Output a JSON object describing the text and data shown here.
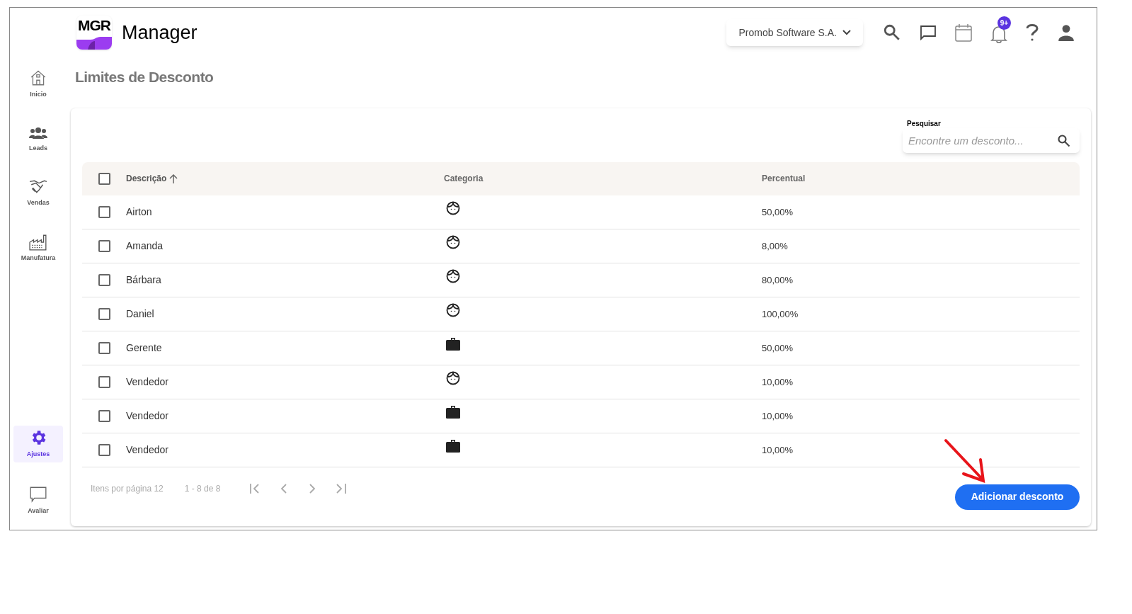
{
  "header": {
    "logo_text": "MGR",
    "app_name": "Manager",
    "company": "Promob Software S.A.",
    "notification_badge": "9+"
  },
  "sidebar": {
    "items": [
      {
        "label": "Inicio",
        "kind": "home",
        "selected": false
      },
      {
        "label": "Leads",
        "kind": "people",
        "selected": false
      },
      {
        "label": "Vendas",
        "kind": "handshake",
        "selected": false
      },
      {
        "label": "Manufatura",
        "kind": "factory",
        "selected": false
      },
      {
        "label": "Ajustes",
        "kind": "gear",
        "selected": true
      },
      {
        "label": "Avaliar",
        "kind": "comment",
        "selected": false
      }
    ]
  },
  "page_title": "Limites de Desconto",
  "search": {
    "label": "Pesquisar",
    "placeholder": "Encontre um desconto..."
  },
  "table": {
    "columns": [
      {
        "label": "Descrição",
        "sorted": true
      },
      {
        "label": "Categoria",
        "sorted": false
      },
      {
        "label": "Percentual",
        "sorted": false
      }
    ],
    "all_checked": false,
    "rows": [
      {
        "checked": false,
        "description": "Airton",
        "kind": "person",
        "percent": "50,00%"
      },
      {
        "checked": false,
        "description": "Amanda",
        "kind": "person",
        "percent": "8,00%"
      },
      {
        "checked": false,
        "description": "Bárbara",
        "kind": "person",
        "percent": "80,00%"
      },
      {
        "checked": false,
        "description": "Daniel",
        "kind": "person",
        "percent": "100,00%"
      },
      {
        "checked": false,
        "description": "Gerente",
        "kind": "role",
        "percent": "50,00%"
      },
      {
        "checked": false,
        "description": "Vendedor",
        "kind": "person",
        "percent": "10,00%"
      },
      {
        "checked": false,
        "description": "Vendedor",
        "kind": "role",
        "percent": "10,00%"
      },
      {
        "checked": false,
        "description": "Vendedor",
        "kind": "role",
        "percent": "10,00%"
      }
    ]
  },
  "pagination": {
    "per_page": "Itens por página 12",
    "range": "1 - 8 de 8"
  },
  "add_button": "Adicionar desconto"
}
